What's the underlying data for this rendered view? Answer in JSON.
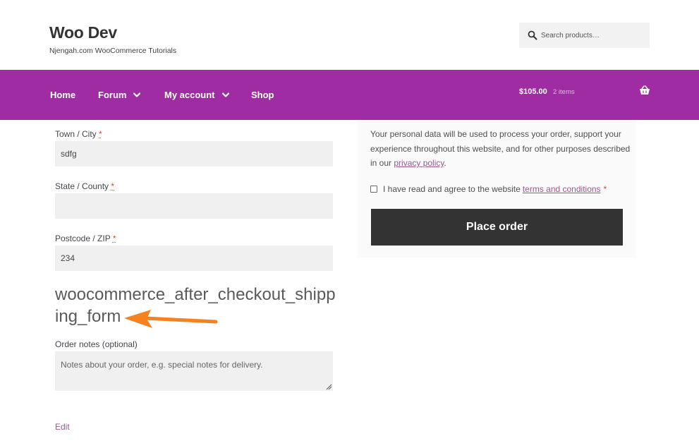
{
  "header": {
    "site_title": "Woo Dev",
    "tagline": "Njengah.com WooCommerce Tutorials",
    "search_placeholder": "Search products…"
  },
  "nav": {
    "items": [
      {
        "label": "Home"
      },
      {
        "label": "Forum",
        "has_dropdown": true
      },
      {
        "label": "My account",
        "has_dropdown": true
      },
      {
        "label": "Shop"
      }
    ],
    "cart_amount": "$105.00",
    "cart_count": "2 items",
    "brand_color": "#a02ca4"
  },
  "form": {
    "town_label": "Town / City",
    "town_value": "sdfg",
    "state_label": "State / County",
    "state_value": "",
    "postcode_label": "Postcode / ZIP",
    "postcode_value": "234",
    "required_mark": "*",
    "hook_text": "woocommerce_after_checkout_shipping_form",
    "notes_label": "Order notes (optional)",
    "notes_placeholder": "Notes about your order, e.g. special notes for delivery.",
    "edit_label": "Edit"
  },
  "order": {
    "privacy_before": "Your personal data will be used to process your order, support your experience throughout this website, and for other purposes described in our ",
    "privacy_link": "privacy policy",
    "privacy_after": ".",
    "terms_before": "I have read and agree to the website",
    "terms_link": "terms and conditions",
    "terms_star": "*",
    "place_order_label": "Place order"
  },
  "colors": {
    "arrow": "#f5821f",
    "button_bg": "#333333",
    "link": "#96588a",
    "required": "#e2401c"
  }
}
